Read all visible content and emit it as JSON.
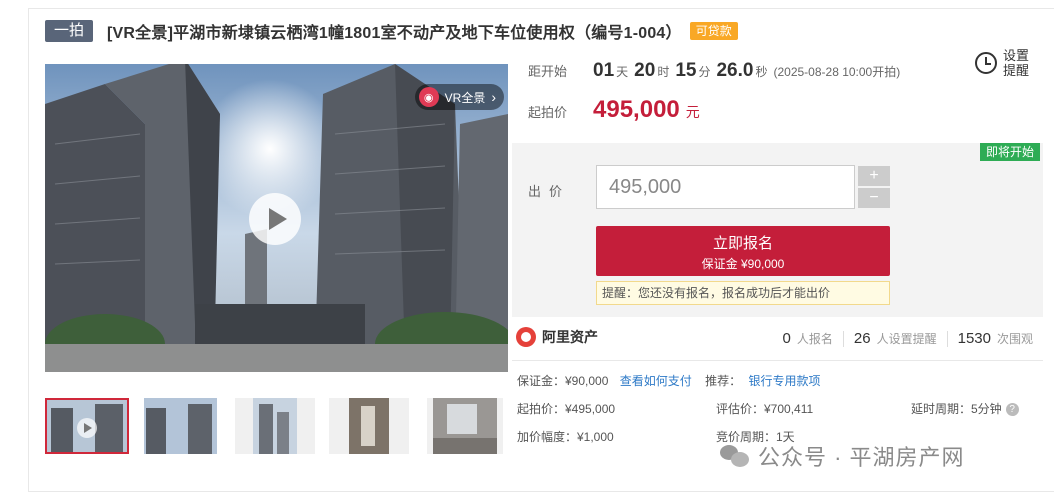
{
  "header": {
    "tag": "一拍",
    "title": "[VR全景]平湖市新埭镇云栖湾1幢1801室不动产及地下车位使用权（编号1-004）",
    "loan_badge": "可贷款"
  },
  "media": {
    "vr_label": "VR全景",
    "vr_chevron": "›"
  },
  "countdown": {
    "label": "距开始",
    "days": "01",
    "days_unit": "天",
    "hours": "20",
    "hours_unit": "时",
    "minutes": "15",
    "minutes_unit": "分",
    "seconds": "26.0",
    "seconds_unit": "秒",
    "start_time": "(2025-08-28 10:00开拍)"
  },
  "remind": {
    "label": "设置提醒"
  },
  "start_price": {
    "label": "起拍价",
    "value": "495,000",
    "unit": "元"
  },
  "bid": {
    "status_badge": "即将开始",
    "label": "出价",
    "value": "495,000",
    "plus": "+",
    "minus": "−",
    "signup_label": "立即报名",
    "deposit_label": "保证金 ¥90,000",
    "notice": "提醒：您还没有报名，报名成功后才能出价"
  },
  "brand": {
    "name": "阿里资产"
  },
  "stats": {
    "signups": "0",
    "signups_label": "人报名",
    "reminders": "26",
    "reminders_label": "人设置提醒",
    "views": "1530",
    "views_label": "次围观"
  },
  "details": {
    "deposit": "保证金：¥90,000",
    "pay_link": "查看如何支付",
    "recommend_label": "推荐：",
    "bank_link": "银行专用款项",
    "start_price": "起拍价：¥495,000",
    "appraisal": "评估价：¥700,411",
    "delay_period": "延时周期：5分钟",
    "help": "?",
    "increment": "加价幅度：¥1,000",
    "auction_period": "竞价周期：1天"
  },
  "watermark": {
    "text": "公众号 · 平湖房产网"
  },
  "colors": {
    "accent": "#c41e3a",
    "badge_green": "#2eac55",
    "loan_orange": "#f9a825",
    "link": "#2e7ac7"
  }
}
